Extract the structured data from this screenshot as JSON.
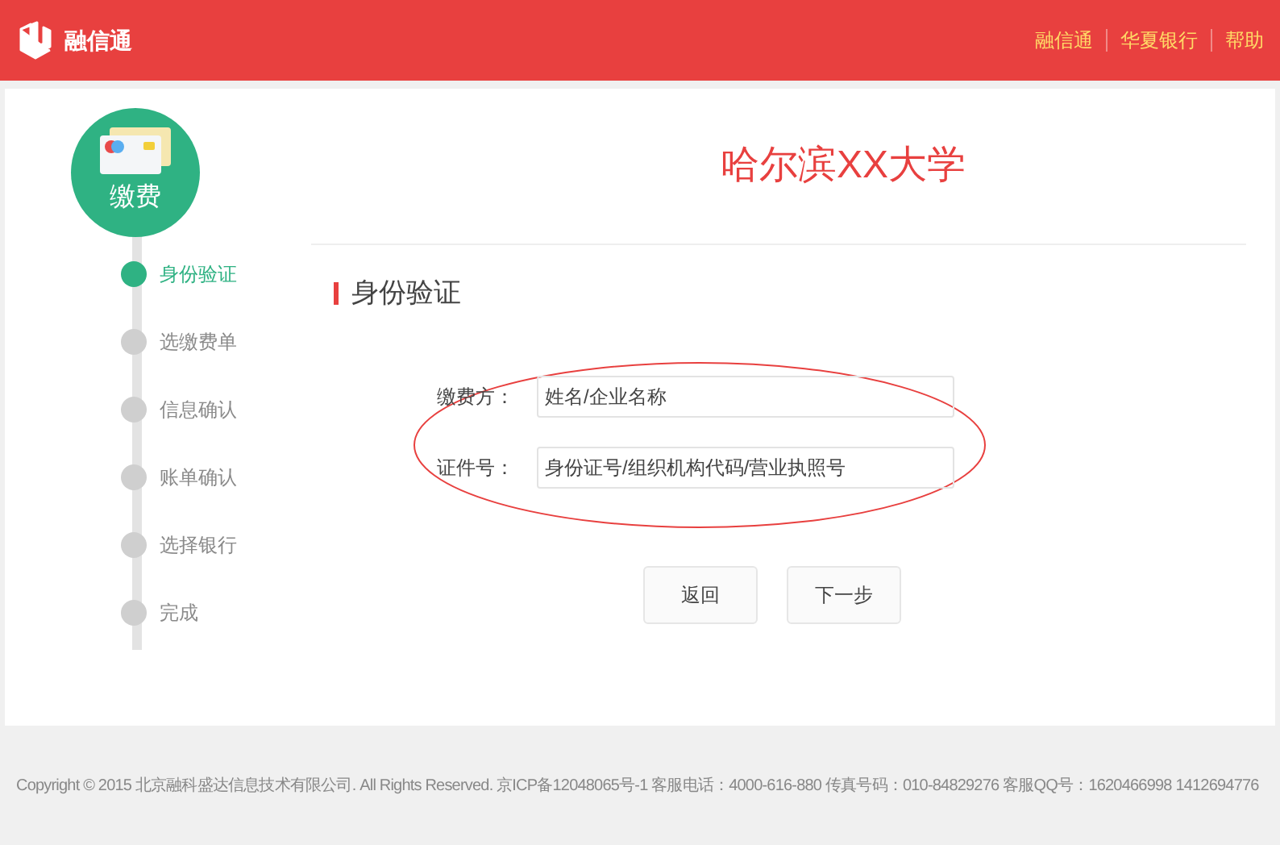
{
  "header": {
    "brand": "融信通",
    "links": [
      "融信通",
      "华夏银行",
      "帮助"
    ]
  },
  "sidebar": {
    "badge_label": "缴费",
    "steps": [
      {
        "label": "身份验证",
        "selected": true
      },
      {
        "label": "选缴费单",
        "selected": false
      },
      {
        "label": "信息确认",
        "selected": false
      },
      {
        "label": "账单确认",
        "selected": false
      },
      {
        "label": "选择银行",
        "selected": false
      },
      {
        "label": "完成",
        "selected": false
      }
    ]
  },
  "main": {
    "title": "哈尔滨XX大学",
    "section_title": "身份验证",
    "fields": [
      {
        "label": "缴费方：",
        "placeholder": "姓名/企业名称"
      },
      {
        "label": "证件号：",
        "placeholder": "身份证号/组织机构代码/营业执照号"
      }
    ],
    "buttons": [
      "返回",
      "下一步"
    ]
  },
  "footer": "Copyright © 2015 北京融科盛达信息技术有限公司. All Rights Reserved. 京ICP备12048065号-1 客服电话：4000-616-880 传真号码：010-84829276 客服QQ号：1620466998 1412694776"
}
